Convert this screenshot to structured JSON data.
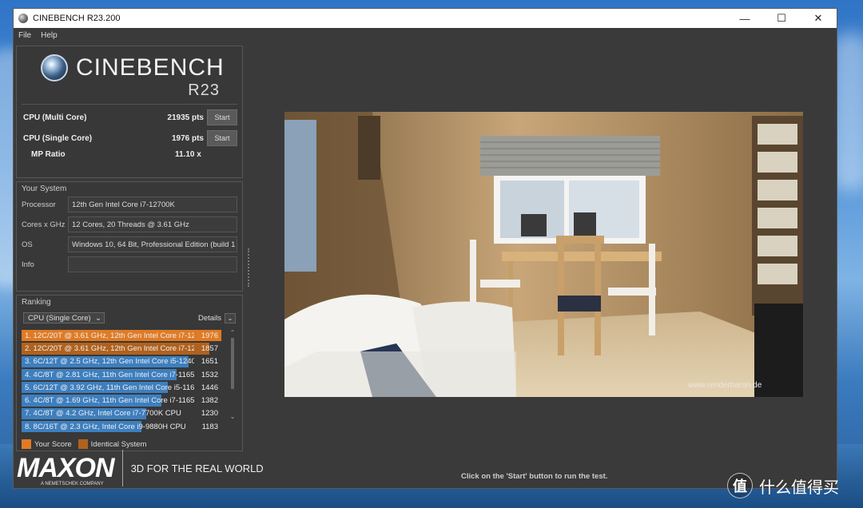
{
  "window": {
    "title": "CINEBENCH R23.200",
    "minimize": "—",
    "maximize": "☐",
    "close": "✕"
  },
  "menu": [
    "File",
    "Help"
  ],
  "logo": {
    "name": "CINEBENCH",
    "version": "R23"
  },
  "scores": {
    "multi_label": "CPU (Multi Core)",
    "multi_value": "21935 pts",
    "single_label": "CPU (Single Core)",
    "single_value": "1976 pts",
    "start_label": "Start",
    "ratio_label": "MP Ratio",
    "ratio_value": "11.10 x"
  },
  "system": {
    "title": "Your System",
    "rows": [
      {
        "label": "Processor",
        "value": "12th Gen Intel Core i7-12700K"
      },
      {
        "label": "Cores x GHz",
        "value": "12 Cores, 20 Threads @ 3.61 GHz"
      },
      {
        "label": "OS",
        "value": "Windows 10, 64 Bit, Professional Edition (build 1"
      },
      {
        "label": "Info",
        "value": ""
      }
    ]
  },
  "ranking": {
    "title": "Ranking",
    "dropdown": "CPU (Single Core)",
    "details": "Details",
    "max_score": 1976,
    "rows": [
      {
        "text": "1. 12C/20T @ 3.61 GHz, 12th Gen Intel Core i7-12",
        "score": 1976,
        "kind": "yours"
      },
      {
        "text": "2. 12C/20T @ 3.61 GHz, 12th Gen Intel Core i7-12",
        "score": 1857,
        "kind": "identical"
      },
      {
        "text": "3. 6C/12T @ 2.5 GHz, 12th Gen Intel Core i5-1240",
        "score": 1651,
        "kind": "other"
      },
      {
        "text": "4. 4C/8T @ 2.81 GHz, 11th Gen Intel Core i7-1165",
        "score": 1532,
        "kind": "other"
      },
      {
        "text": "5. 6C/12T @ 3.92 GHz, 11th Gen Intel Core i5-1160",
        "score": 1446,
        "kind": "other"
      },
      {
        "text": "6. 4C/8T @ 1.69 GHz, 11th Gen Intel Core i7-1165",
        "score": 1382,
        "kind": "other"
      },
      {
        "text": "7. 4C/8T @ 4.2 GHz, Intel Core i7-7700K CPU",
        "score": 1230,
        "kind": "other"
      },
      {
        "text": "8. 8C/16T @ 2.3 GHz, Intel Core i9-9880H CPU",
        "score": 1183,
        "kind": "other"
      }
    ],
    "legend_yours": "Your Score",
    "legend_identical": "Identical System"
  },
  "colors": {
    "yours": "#e07b25",
    "identical": "#b0621e",
    "other": "#3d7fbf"
  },
  "render": {
    "watermark": "www.renderbaron.de"
  },
  "brand": {
    "maxon": "MAXON",
    "maxon_sub": "A NEMETSCHEK COMPANY",
    "tagline": "3D FOR THE REAL WORLD"
  },
  "status": "Click on the 'Start' button to run the test.",
  "overlay": {
    "icon_glyph": "值",
    "text": "什么值得买"
  }
}
